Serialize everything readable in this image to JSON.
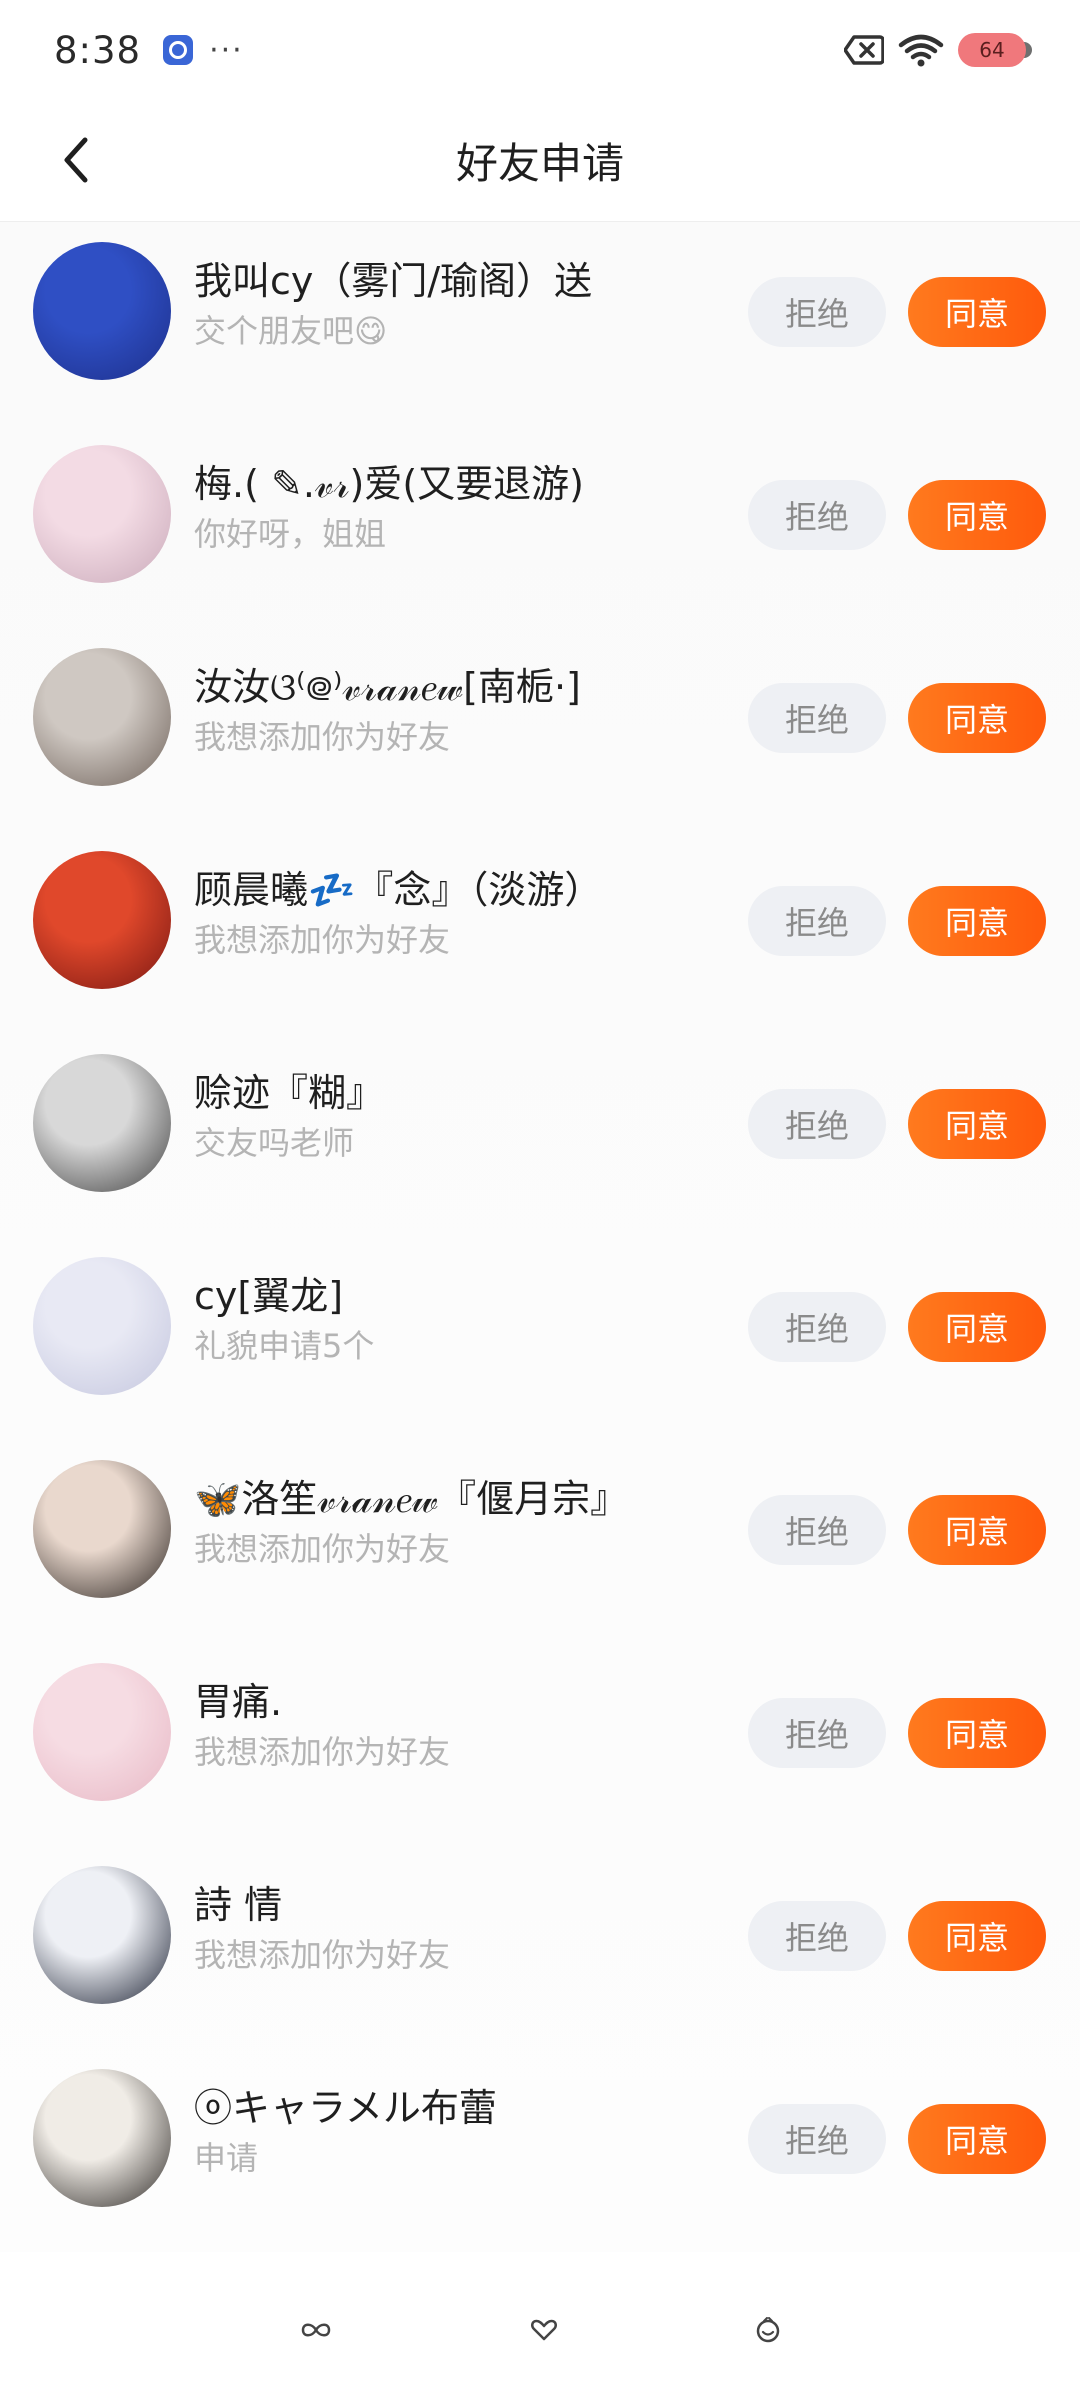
{
  "status_bar": {
    "time": "8:38",
    "more": "···",
    "battery": "64"
  },
  "header": {
    "title": "好友申请"
  },
  "buttons": {
    "reject": "拒绝",
    "agree": "同意"
  },
  "requests": [
    {
      "name": "我叫cy（雾门/瑜阁）送",
      "message": "交个朋友吧😋",
      "avatar_colors": [
        "#2f4fc4",
        "#1d2f8a"
      ]
    },
    {
      "name": "梅.( ✎.𝓋𝓇)爱(又要退游)",
      "message": "你好呀，姐姐",
      "avatar_colors": [
        "#f3dbe4",
        "#c9a9b9"
      ]
    },
    {
      "name": "汝汝ଓ⁽᪤⁾𝓋𝓇𝒶𝓃𝑒𝓌[南栀·]",
      "message": "我想添加你为好友",
      "avatar_colors": [
        "#cfc8c2",
        "#6e6159"
      ]
    },
    {
      "name": "顾晨曦💤『念』（淡游）",
      "message": "我想添加你为好友",
      "avatar_colors": [
        "#e0482b",
        "#7a1712"
      ]
    },
    {
      "name": "赊迹『糊』",
      "message": "交友吗老师",
      "avatar_colors": [
        "#d8d8d8",
        "#3f3f3f"
      ]
    },
    {
      "name": "cy[翼龙]",
      "message": "礼貌申请5个",
      "avatar_colors": [
        "#e8e9f4",
        "#c4c6de"
      ]
    },
    {
      "name": "🦋洛笙𝓋𝓇𝒶𝓃𝑒𝓌『偃月宗』",
      "message": "我想添加你为好友",
      "avatar_colors": [
        "#e9d8cd",
        "#2b2420"
      ]
    },
    {
      "name": "胃痛.",
      "message": "我想添加你为好友",
      "avatar_colors": [
        "#f6dce3",
        "#e7b7c4"
      ]
    },
    {
      "name": "詩 情",
      "message": "我想添加你为好友",
      "avatar_colors": [
        "#eef0f5",
        "#1c2233"
      ]
    },
    {
      "name": "ⓞキャラメル布蕾",
      "message": "申请",
      "avatar_colors": [
        "#f0ece6",
        "#2d2926"
      ]
    }
  ],
  "colors": {
    "accent": "#ff6112",
    "reject_bg": "#eef0f4",
    "secondary_text": "#b4b4b4"
  }
}
